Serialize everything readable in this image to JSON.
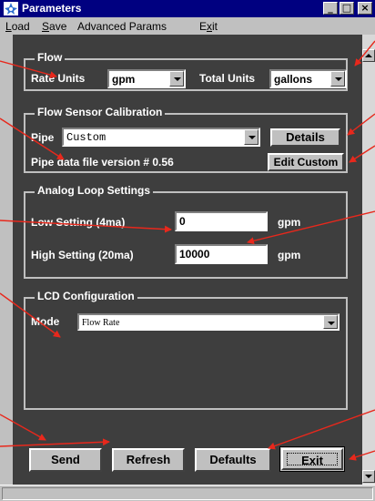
{
  "window": {
    "title": "Parameters",
    "min_glyph": "_",
    "max_glyph": "□",
    "close_glyph": "×"
  },
  "menu": {
    "load": {
      "key": "L",
      "rest": "oad"
    },
    "save": {
      "key": "S",
      "rest": "ave"
    },
    "advanced": "Advanced Params",
    "exit": {
      "pre": "E",
      "key": "x",
      "rest": "it"
    }
  },
  "flow": {
    "title": "Flow",
    "rate_label": "Rate Units",
    "rate_value": "gpm",
    "total_label": "Total Units",
    "total_value": "gallons"
  },
  "calibration": {
    "title": "Flow Sensor Calibration",
    "pipe_label": "Pipe",
    "pipe_value": "Custom",
    "details_label": "Details",
    "version_text": "Pipe data file version # 0.56",
    "edit_custom_label": "Edit Custom"
  },
  "analog": {
    "title": "Analog Loop Settings",
    "low_label": "Low Setting (4ma)",
    "low_value": "0",
    "low_unit": "gpm",
    "high_label": "High Setting (20ma)",
    "high_value": "10000",
    "high_unit": "gpm"
  },
  "lcd": {
    "title": "LCD Configuration",
    "mode_label": "Mode",
    "mode_value": "Flow Rate"
  },
  "buttons": {
    "send": "Send",
    "refresh": "Refresh",
    "defaults": "Defaults",
    "exit": "Exit"
  },
  "colors": {
    "annotation_arrow": "#e8281c",
    "panel_bg": "#3e3e3e",
    "titlebar": "#000080"
  }
}
